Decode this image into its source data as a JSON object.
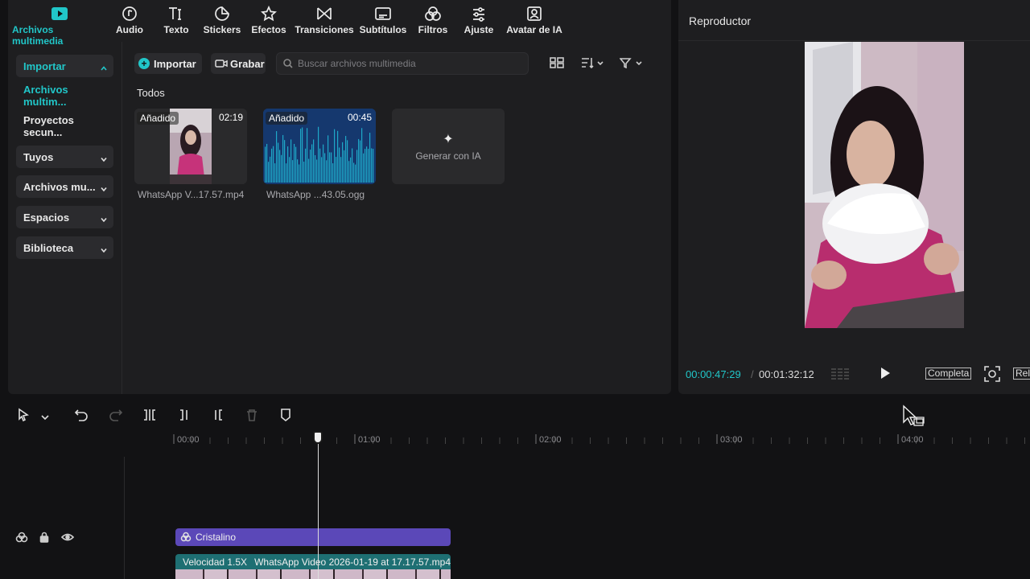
{
  "toolbar": {
    "tabs": [
      {
        "label": "Archivos multimedia",
        "icon": "media-play-icon",
        "active": true
      },
      {
        "label": "Audio",
        "icon": "audio-icon"
      },
      {
        "label": "Texto",
        "icon": "text-icon"
      },
      {
        "label": "Stickers",
        "icon": "sticker-icon"
      },
      {
        "label": "Efectos",
        "icon": "effects-star-icon"
      },
      {
        "label": "Transiciones",
        "icon": "transition-icon"
      },
      {
        "label": "Subtítulos",
        "icon": "subtitles-icon"
      },
      {
        "label": "Filtros",
        "icon": "filters-icon"
      },
      {
        "label": "Ajuste",
        "icon": "adjust-sliders-icon"
      },
      {
        "label": "Avatar de IA",
        "icon": "ai-avatar-icon"
      }
    ]
  },
  "sidebar": {
    "items": [
      {
        "label": "Importar",
        "expanded": true
      },
      {
        "label": "Archivos multim...",
        "selected": true
      },
      {
        "label": "Proyectos secun..."
      },
      {
        "label": "Tuyos"
      },
      {
        "label": "Archivos mu..."
      },
      {
        "label": "Espacios"
      },
      {
        "label": "Biblioteca"
      }
    ]
  },
  "media": {
    "import_label": "Importar",
    "record_label": "Grabar",
    "search_placeholder": "Buscar archivos multimedia",
    "section_title": "Todos",
    "items": [
      {
        "badge": "Añadido",
        "duration": "02:19",
        "name": "WhatsApp V...17.57.mp4",
        "kind": "video"
      },
      {
        "badge": "Añadido",
        "duration": "00:45",
        "name": "WhatsApp ...43.05.ogg",
        "kind": "audio"
      }
    ],
    "generate_label": "Generar con IA"
  },
  "player": {
    "title": "Reproductor",
    "current_time": "00:00:47:29",
    "separator": "/",
    "total_time": "00:01:32:12",
    "full_label": "Completa",
    "ratio_label": "Relación"
  },
  "timeline": {
    "ruler": [
      "00:00",
      "01:00",
      "02:00",
      "03:00",
      "04:00"
    ],
    "effect_clip": "Cristalino",
    "video_clip_speed": "Velocidad 1.5X",
    "video_clip_name": "WhatsApp Video 2026-01-19 at 17.17.57.mp4"
  },
  "colors": {
    "accent": "#21c6c8",
    "effect_clip": "#5b48b8",
    "video_clip": "#1e6f73",
    "panel": "#1e1e20"
  }
}
